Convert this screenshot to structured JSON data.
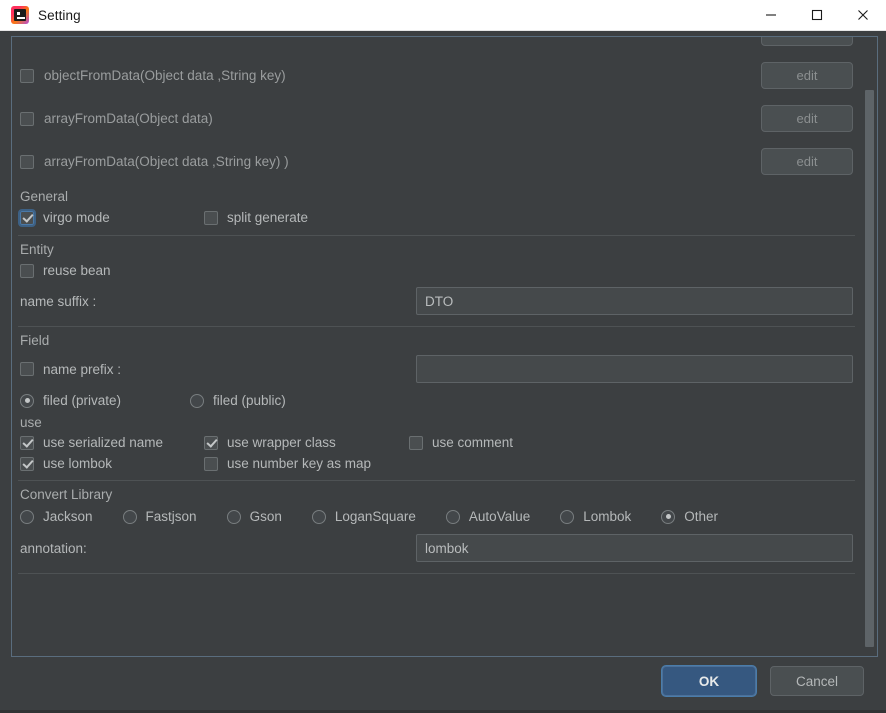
{
  "window": {
    "title": "Setting",
    "icon": "intellij-logo-icon",
    "controls": {
      "minimize": "minimize-icon",
      "maximize": "maximize-icon",
      "close": "close-icon"
    }
  },
  "methods": [
    {
      "label": "objectFromData(Object data ,String key)",
      "checked": false,
      "button": "edit"
    },
    {
      "label": "arrayFromData(Object data)",
      "checked": false,
      "button": "edit"
    },
    {
      "label": "arrayFromData(Object data ,String key) )",
      "checked": false,
      "button": "edit"
    }
  ],
  "general": {
    "title": "General",
    "options": [
      {
        "label": "virgo mode",
        "checked": true,
        "focused": true
      },
      {
        "label": "split generate",
        "checked": false,
        "focused": false
      }
    ]
  },
  "entity": {
    "title": "Entity",
    "reuse_bean": {
      "label": "reuse bean",
      "checked": false
    },
    "name_suffix": {
      "label": "name suffix :",
      "value": "DTO",
      "placeholder": ""
    }
  },
  "field": {
    "title": "Field",
    "name_prefix": {
      "label": "name prefix :",
      "checked": false,
      "value": "",
      "placeholder": ""
    },
    "visibility": [
      {
        "label": "filed (private)",
        "selected": true
      },
      {
        "label": "filed (public)",
        "selected": false
      }
    ]
  },
  "use": {
    "title": "use",
    "options_row1": [
      {
        "label": "use serialized name",
        "checked": true
      },
      {
        "label": "use wrapper class",
        "checked": true
      },
      {
        "label": "use comment",
        "checked": false
      }
    ],
    "options_row2": [
      {
        "label": "use lombok",
        "checked": true
      },
      {
        "label": "use number key as map",
        "checked": false
      }
    ]
  },
  "convert_library": {
    "title": "Convert Library",
    "options": [
      {
        "label": "Jackson",
        "selected": false
      },
      {
        "label": "Fastjson",
        "selected": false
      },
      {
        "label": "Gson",
        "selected": false
      },
      {
        "label": "LoganSquare",
        "selected": false
      },
      {
        "label": "AutoValue",
        "selected": false
      },
      {
        "label": "Lombok",
        "selected": false
      },
      {
        "label": "Other",
        "selected": true
      }
    ],
    "annotation": {
      "label": "annotation:",
      "value": "lombok",
      "placeholder": ""
    }
  },
  "footer": {
    "ok_label": "OK",
    "cancel_label": "Cancel"
  },
  "colors": {
    "background": "#3c3f41",
    "accent": "#365880",
    "text": "#b5b8b9",
    "muted_text": "#9a9d9e",
    "border": "#5e6366",
    "focus_ring": "#4a79a8"
  }
}
